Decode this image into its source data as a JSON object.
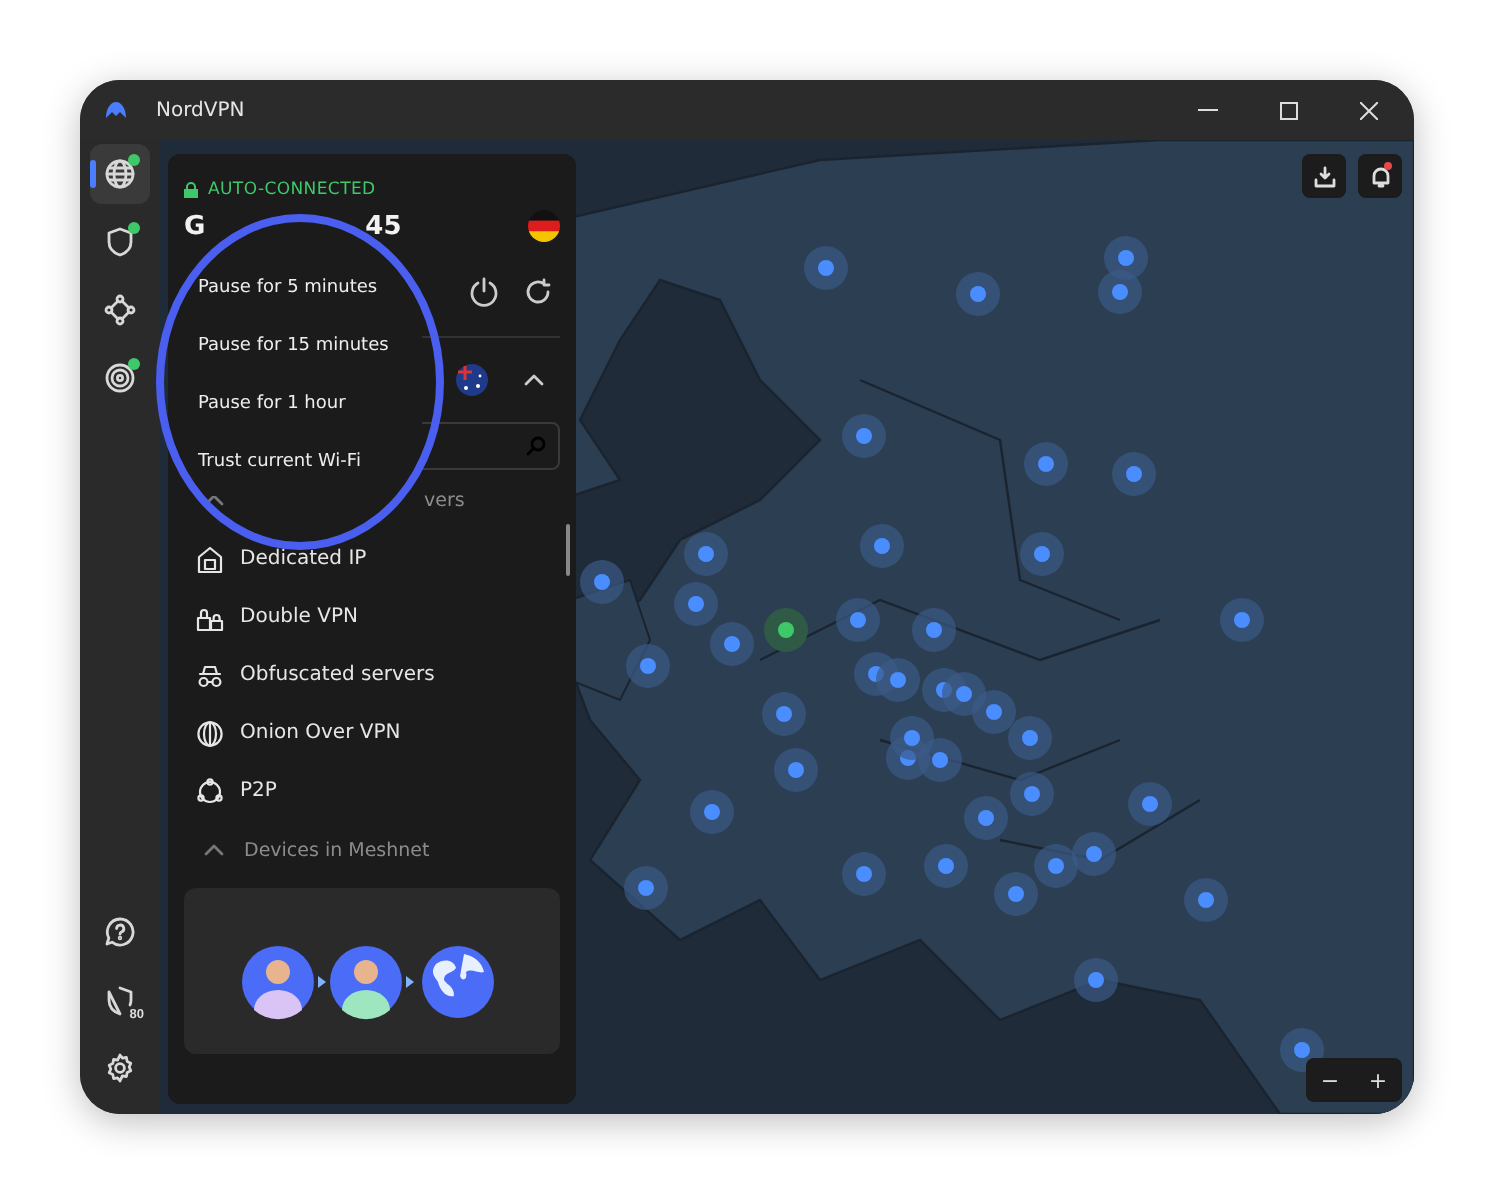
{
  "window": {
    "title": "NordVPN"
  },
  "rail": {
    "items": [
      {
        "kind": "globe",
        "selected": true,
        "status": true
      },
      {
        "kind": "shield",
        "selected": false,
        "status": true
      },
      {
        "kind": "mesh",
        "selected": false,
        "status": false
      },
      {
        "kind": "radar",
        "selected": false,
        "status": true
      }
    ],
    "bottom": [
      {
        "kind": "help"
      },
      {
        "kind": "threat",
        "badge": "80"
      },
      {
        "kind": "settings"
      }
    ]
  },
  "connection": {
    "status": "AUTO-CONNECTED",
    "title_start": "G",
    "title_end": "45"
  },
  "pause_menu": {
    "items": [
      "Pause for 5 minutes",
      "Pause for 15 minutes",
      "Pause for 1 hour",
      "Trust current Wi-Fi"
    ]
  },
  "servers_heading": "vers",
  "servers": [
    {
      "kind": "dedicated",
      "label": "Dedicated IP"
    },
    {
      "kind": "double",
      "label": "Double VPN"
    },
    {
      "kind": "obfuscated",
      "label": "Obfuscated servers"
    },
    {
      "kind": "onion",
      "label": "Onion Over VPN"
    },
    {
      "kind": "p2p",
      "label": "P2P"
    }
  ],
  "meshnet_heading": "Devices in Meshnet",
  "zoom": {
    "out": "−",
    "in": "+"
  }
}
